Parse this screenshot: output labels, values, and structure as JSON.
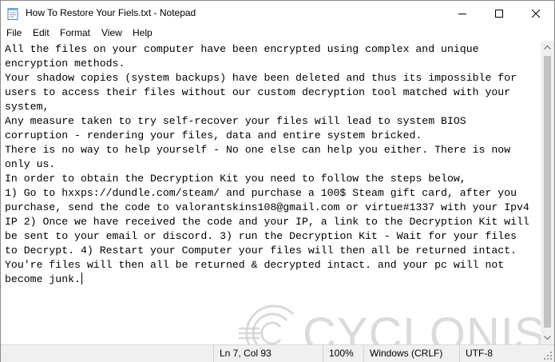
{
  "window": {
    "title": "How To Restore Your Fiels.txt - Notepad",
    "controls": [
      "minimize",
      "maximize",
      "close"
    ]
  },
  "menu": {
    "items": [
      {
        "label": "File"
      },
      {
        "label": "Edit"
      },
      {
        "label": "Format"
      },
      {
        "label": "View"
      },
      {
        "label": "Help"
      }
    ]
  },
  "editor": {
    "lines": [
      "All the files on your computer have been encrypted using complex and unique",
      "encryption methods.",
      "Your shadow copies (system backups) have been deleted and thus its impossible for",
      "users to access their files without our custom decryption tool matched with your",
      "system,",
      "Any measure taken to try self-recover your files will lead to system BIOS",
      "corruption - rendering your files, data and entire system bricked.",
      "There is no way to help yourself - No one else can help you either. There is now",
      "only us.",
      "In order to obtain the Decryption Kit you need to follow the steps below,",
      "1) Go to hxxps://dundle.com/steam/ and purchase a 100$ Steam gift card, after you",
      "purchase, send the code to valorantskins108@gmail.com or virtue#1337 with your Ipv4",
      "IP 2) Once we have received the code and your IP, a link to the Decryption Kit will",
      "be sent to your email or discord. 3) run the Decryption Kit - Wait for your files",
      "to Decrypt. 4) Restart your Computer your files will then all be returned intact.",
      "You're files will then all be returned & decrypted intact. and your pc will not",
      "become junk."
    ]
  },
  "status": {
    "position": "Ln 7, Col 93",
    "zoom": "100%",
    "line_ending": "Windows (CRLF)",
    "encoding": "UTF-8"
  },
  "watermark": {
    "text": "CYCLONIS"
  }
}
